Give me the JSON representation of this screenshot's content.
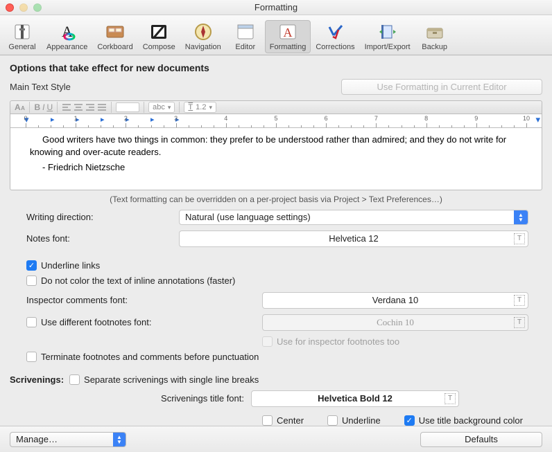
{
  "window": {
    "title": "Formatting"
  },
  "toolbar": {
    "items": [
      {
        "label": "General"
      },
      {
        "label": "Appearance"
      },
      {
        "label": "Corkboard"
      },
      {
        "label": "Compose"
      },
      {
        "label": "Navigation"
      },
      {
        "label": "Editor"
      },
      {
        "label": "Formatting"
      },
      {
        "label": "Corrections"
      },
      {
        "label": "Import/Export"
      },
      {
        "label": "Backup"
      }
    ],
    "active_index": 6
  },
  "headings": {
    "options": "Options that take effect for new documents",
    "main_text_style": "Main Text Style",
    "use_formatting_btn": "Use Formatting in Current Editor"
  },
  "mini": {
    "caps": "Aa",
    "bold": "B",
    "italic": "I",
    "underline": "U",
    "style_chip": "abc",
    "line_icon": "T",
    "line_val": "1.2"
  },
  "preview": {
    "line1": "Good writers have two things in common: they prefer to be understood rather than admired; and they do not write for knowing and over-acute readers.",
    "line2": "- Friedrich Nietzsche"
  },
  "note": "(Text formatting can be overridden on a per-project basis via Project > Text Preferences…)",
  "form": {
    "writing_dir_label": "Writing direction:",
    "writing_dir_value": "Natural (use language settings)",
    "notes_font_label": "Notes font:",
    "notes_font_value": "Helvetica 12",
    "inspector_font_label": "Inspector comments font:",
    "inspector_font_value": "Verdana 10",
    "diff_footnotes_label": "Use different footnotes font:",
    "diff_footnotes_value": "Cochin 10",
    "scrivenings_title_label": "Scrivenings title font:",
    "scrivenings_title_value": "Helvetica Bold 12"
  },
  "checks": {
    "underline_links": "Underline links",
    "no_color_inline": "Do not color the text of inline annotations (faster)",
    "use_inspector_footnotes": "Use for inspector footnotes too",
    "terminate": "Terminate footnotes and comments before punctuation",
    "scrivenings_head": "Scrivenings:",
    "separate": "Separate scrivenings with single line breaks",
    "center": "Center",
    "underline": "Underline",
    "title_bg": "Use title background  color"
  },
  "footer": {
    "manage": "Manage…",
    "defaults": "Defaults"
  }
}
